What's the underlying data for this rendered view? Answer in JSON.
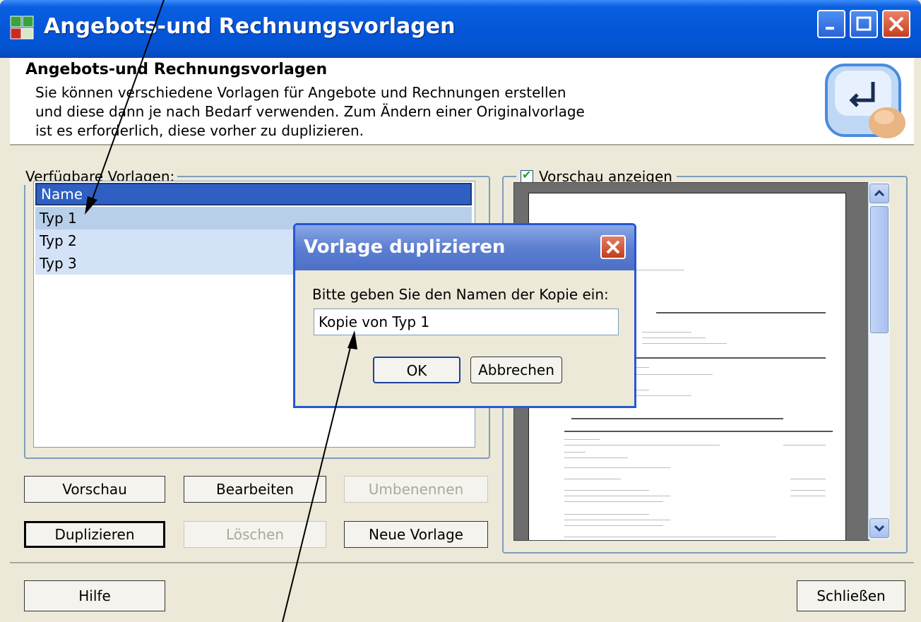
{
  "window": {
    "title": "Angebots-und Rechnungsvorlagen"
  },
  "header": {
    "title": "Angebots-und Rechnungsvorlagen",
    "description": "Sie können verschiedene Vorlagen für Angebote und Rechnungen erstellen\nund diese dann je nach Bedarf verwenden. Zum Ändern einer Originalvorlage\nist es erforderlich, diese vorher zu duplizieren."
  },
  "templates": {
    "group_label": "Verfügbare Vorlagen:",
    "column_header": "Name",
    "items": [
      "Typ 1",
      "Typ 2",
      "Typ 3"
    ]
  },
  "buttons": {
    "preview": "Vorschau",
    "edit": "Bearbeiten",
    "rename": "Umbenennen",
    "duplicate": "Duplizieren",
    "delete": "Löschen",
    "new_template": "Neue Vorlage",
    "help": "Hilfe",
    "close": "Schließen"
  },
  "preview_panel": {
    "checkbox_label": "Vorschau anzeigen",
    "checked": true
  },
  "dialog": {
    "title": "Vorlage duplizieren",
    "prompt": "Bitte geben Sie den Namen der Kopie ein:",
    "input_value": "Kopie von Typ 1",
    "ok": "OK",
    "cancel": "Abbrechen"
  },
  "colors": {
    "titlebar": "#0455d8",
    "dialog_titlebar": "#5d7fd0",
    "list_header": "#2f5fc2",
    "list_item": "#d4e2f7",
    "window_bg": "#ece9d8"
  }
}
